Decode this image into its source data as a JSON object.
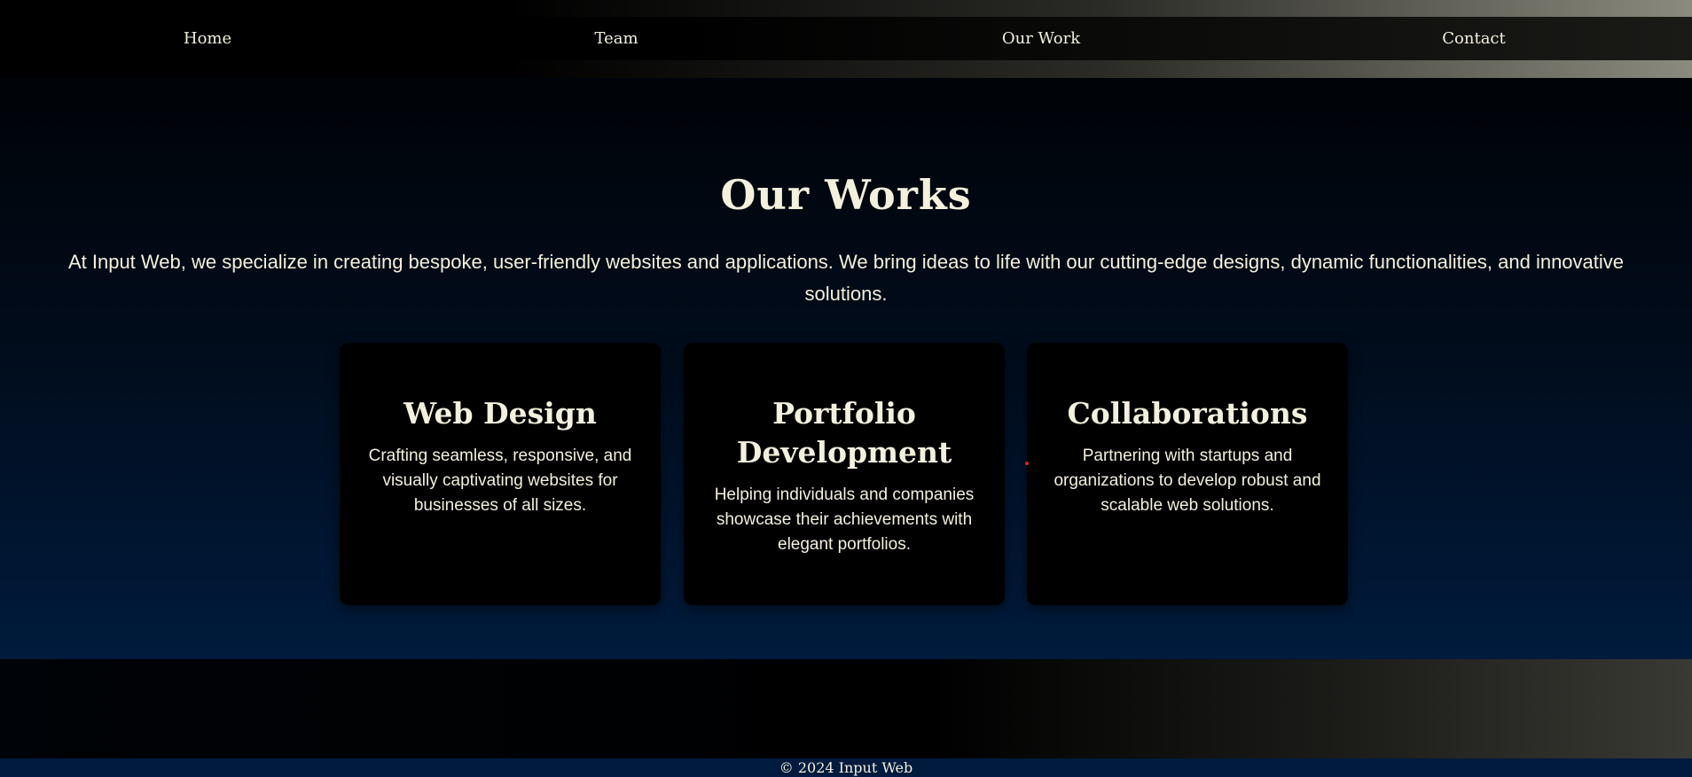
{
  "nav": {
    "items": [
      "Home",
      "Team",
      "Our Work",
      "Contact"
    ]
  },
  "main": {
    "title": "Our Works",
    "intro": "At Input Web, we specialize in creating bespoke, user-friendly websites and applications. We bring ideas to life with our cutting-edge designs, dynamic functionalities, and innovative solutions.",
    "cards": [
      {
        "title": "Web Design",
        "text": "Crafting seamless, responsive, and visually captivating websites for businesses of all sizes."
      },
      {
        "title": "Portfolio Development",
        "text": "Helping individuals and companies showcase their achievements with elegant portfolios."
      },
      {
        "title": "Collaborations",
        "text": "Partnering with startups and organizations to develop robust and scalable web solutions."
      }
    ]
  },
  "footer": {
    "copyright": "© 2024 Input Web"
  },
  "colors": {
    "text": "#f3f0dc",
    "background_top": "#000307",
    "background_bottom": "#001b3d",
    "card": "#000000"
  }
}
